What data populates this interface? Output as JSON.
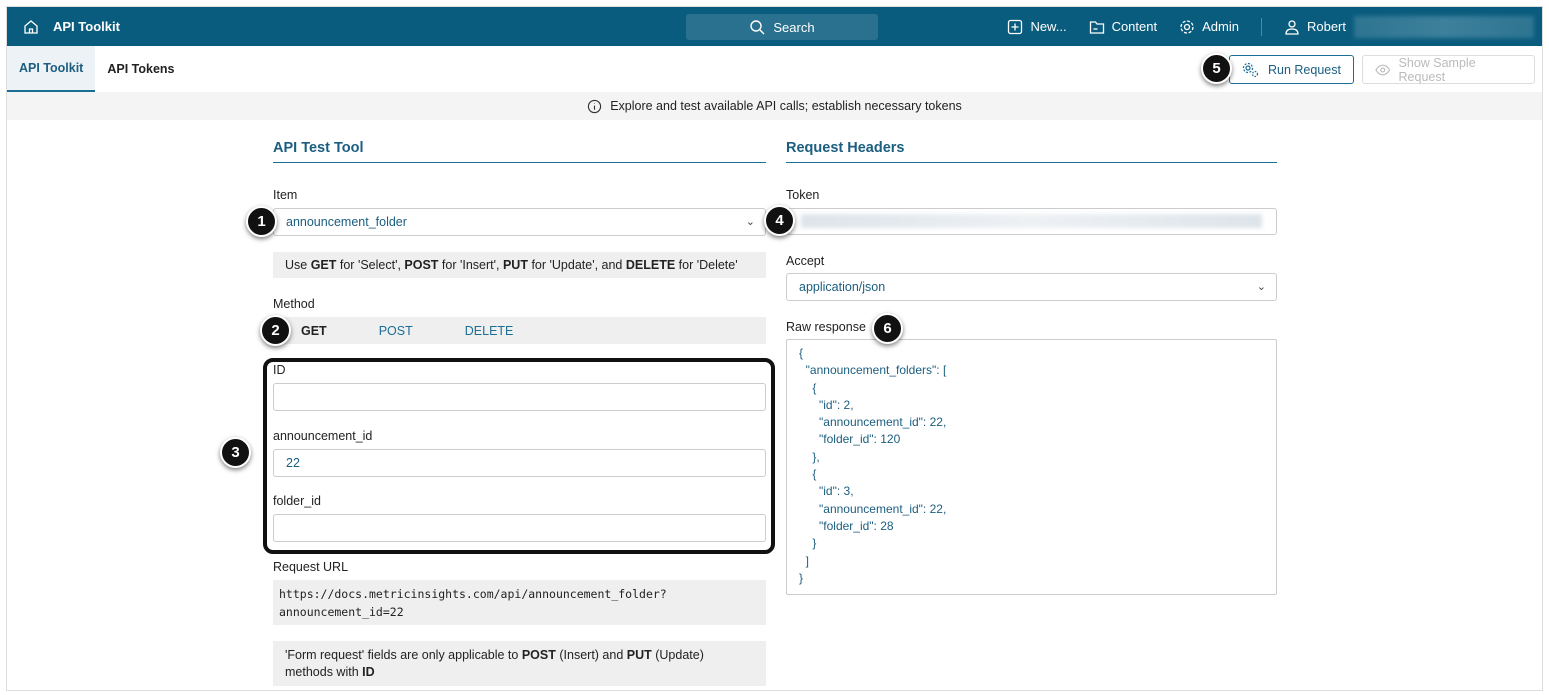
{
  "topbar": {
    "title": "API Toolkit",
    "search": "Search",
    "new": "New...",
    "content": "Content",
    "admin": "Admin",
    "user": "Robert"
  },
  "tabs": [
    "API Toolkit",
    "API Tokens"
  ],
  "buttons": {
    "run": "Run Request",
    "sample": "Show Sample Request"
  },
  "info": "Explore and test available API calls; establish necessary tokens",
  "left": {
    "title": "API Test Tool",
    "item_label": "Item",
    "item_value": "announcement_folder",
    "hint": [
      {
        "t": "Use ",
        "b": false
      },
      {
        "t": "GET",
        "b": true
      },
      {
        "t": " for 'Select', ",
        "b": false
      },
      {
        "t": "POST",
        "b": true
      },
      {
        "t": " for 'Insert', ",
        "b": false
      },
      {
        "t": "PUT",
        "b": true
      },
      {
        "t": " for 'Update', and ",
        "b": false
      },
      {
        "t": "DELETE",
        "b": true
      },
      {
        "t": " for 'Delete'",
        "b": false
      }
    ],
    "method_label": "Method",
    "methods": [
      "GET",
      "POST",
      "DELETE"
    ],
    "fields": [
      {
        "label": "ID",
        "value": ""
      },
      {
        "label": "announcement_id",
        "value": "22"
      },
      {
        "label": "folder_id",
        "value": ""
      }
    ],
    "url_label": "Request URL",
    "url_lines": [
      "https://docs.metricinsights.com/api/announcement_folder?",
      "announcement_id=22"
    ],
    "form_note": [
      {
        "t": "'Form request' fields are only applicable to ",
        "b": false
      },
      {
        "t": "POST",
        "b": true
      },
      {
        "t": " (Insert) and ",
        "b": false
      },
      {
        "t": "PUT",
        "b": true
      },
      {
        "t": " (Update) methods with ",
        "b": false
      },
      {
        "t": "ID",
        "b": true
      }
    ]
  },
  "right": {
    "title": "Request Headers",
    "token_label": "Token",
    "accept_label": "Accept",
    "accept_value": "application/json",
    "raw_label": "Raw response",
    "response": "{\n  \"announcement_folders\": [\n    {\n      \"id\": 2,\n      \"announcement_id\": 22,\n      \"folder_id\": 120\n    },\n    {\n      \"id\": 3,\n      \"announcement_id\": 22,\n      \"folder_id\": 28\n    }\n  ]\n}"
  },
  "markers": [
    "1",
    "2",
    "3",
    "4",
    "5",
    "6"
  ]
}
